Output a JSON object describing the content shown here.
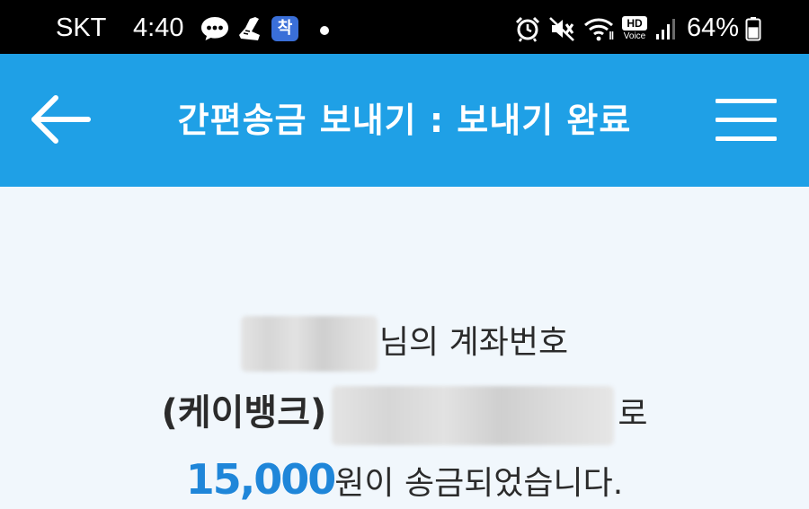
{
  "status_bar": {
    "carrier": "SKT",
    "time": "4:40",
    "battery_percent": "64%",
    "icons": [
      "chat-bubble-icon",
      "shoe-icon",
      "app-badge-icon",
      "alarm-icon",
      "mute-icon",
      "wifi-icon",
      "hd-voice-icon",
      "signal-icon",
      "battery-icon"
    ],
    "hd_label": "HD",
    "voice_label": "Voice",
    "app_badge_label": "착",
    "battery_level": 0.64
  },
  "header": {
    "title": "간편송금 보내기 : 보내기 완료",
    "bar_color": "#1fa0e6"
  },
  "result": {
    "recipient_suffix": "님의 계좌번호",
    "bank_name": "(케이뱅크)",
    "account_suffix": "로",
    "amount": "15,000",
    "amount_suffix": "원이 송금되었습니다.",
    "amount_color": "#1f86d9"
  }
}
